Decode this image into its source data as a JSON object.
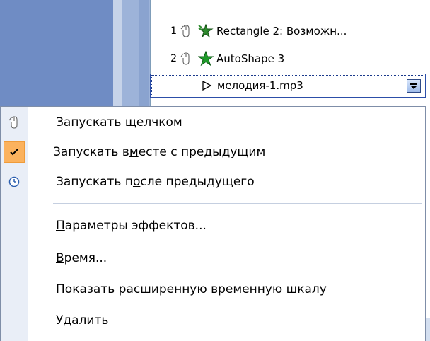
{
  "animation_list": {
    "items": [
      {
        "num": "1",
        "trigger_icon": "mouse-icon",
        "effect_icon": "star-burst-icon",
        "label": "Rectangle 2: Возможн..."
      },
      {
        "num": "2",
        "trigger_icon": "mouse-icon",
        "effect_icon": "green-star-icon",
        "label": "AutoShape 3"
      },
      {
        "num": "",
        "trigger_icon": "",
        "effect_icon": "play-triangle-icon",
        "label": "мелодия-1.mp3"
      }
    ]
  },
  "context_menu": {
    "items": [
      {
        "icon": "mouse-icon",
        "pre": "Запускать ",
        "u": "щ",
        "post": "елчком",
        "checked": false
      },
      {
        "icon": "checkmark-icon",
        "pre": "Запускать в",
        "u": "м",
        "post": "есте с предыдущим",
        "checked": true
      },
      {
        "icon": "clock-icon",
        "pre": "Запускать п",
        "u": "о",
        "post": "сле предыдущего",
        "checked": false
      },
      {
        "icon": "",
        "pre": "",
        "u": "П",
        "post": "араметры эффектов...",
        "checked": false
      },
      {
        "icon": "",
        "pre": "",
        "u": "В",
        "post": "ремя...",
        "checked": false
      },
      {
        "icon": "",
        "pre": "По",
        "u": "к",
        "post": "азать расширенную временную шкалу",
        "checked": false
      },
      {
        "icon": "",
        "pre": "",
        "u": "У",
        "post": "далить",
        "checked": false
      }
    ]
  },
  "colors": {
    "checked_bg": "#fbb25e",
    "menu_gutter": "#e9eef7",
    "pane_blue": "#6f8cc4"
  }
}
